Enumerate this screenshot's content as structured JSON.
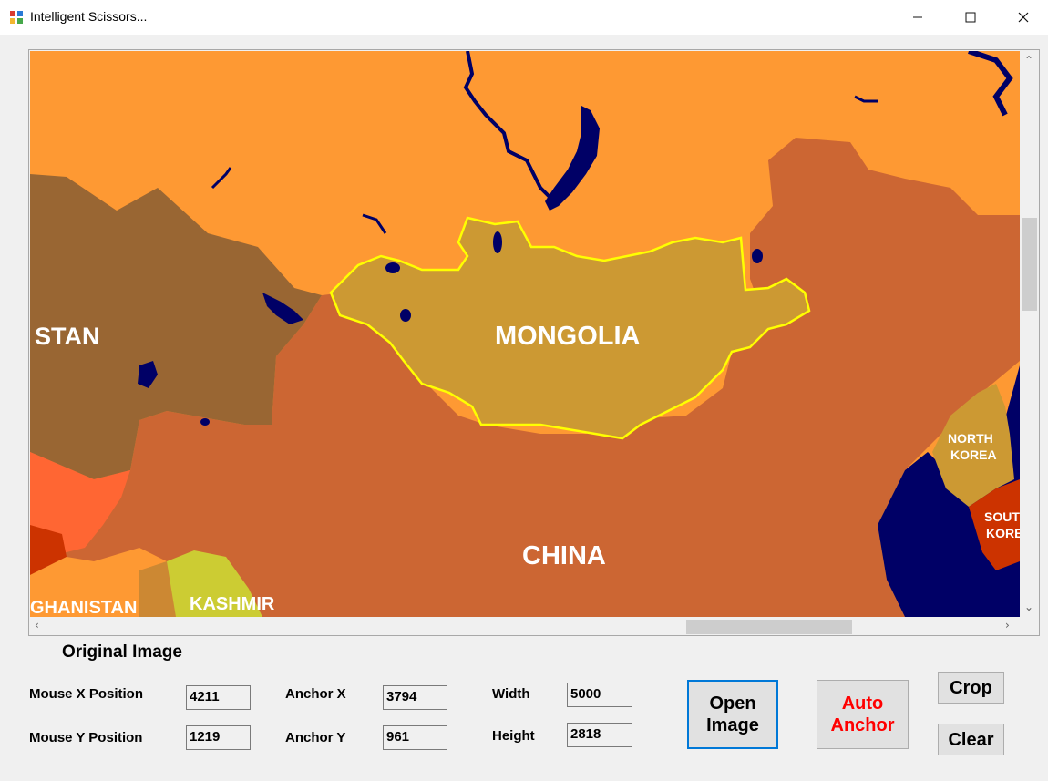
{
  "window": {
    "title": "Intelligent Scissors..."
  },
  "map": {
    "labels": {
      "stan": "STAN",
      "mongolia": "MONGOLIA",
      "china": "CHINA",
      "north_korea_1": "NORTH",
      "north_korea_2": "KOREA",
      "south_korea_1": "SOUT",
      "south_korea_2": "KORE",
      "afghanistan": "GHANISTAN",
      "kashmir": "KASHMIR"
    },
    "selection_color": "#ffff00",
    "water_color": "#000066"
  },
  "panel": {
    "heading": "Original Image",
    "mouse_x_label": "Mouse X Position",
    "mouse_x_value": "4211",
    "mouse_y_label": "Mouse Y Position",
    "mouse_y_value": "1219",
    "anchor_x_label": "Anchor X",
    "anchor_x_value": "3794",
    "anchor_y_label": "Anchor Y",
    "anchor_y_value": "961",
    "width_label": "Width",
    "width_value": "5000",
    "height_label": "Height",
    "height_value": "2818"
  },
  "buttons": {
    "open_line1": "Open",
    "open_line2": "Image",
    "auto_line1": "Auto",
    "auto_line2": "Anchor",
    "crop": "Crop",
    "clear": "Clear"
  },
  "colors": {
    "auto_anchor_text": "#ff0000",
    "open_image_border": "#0078d7"
  }
}
